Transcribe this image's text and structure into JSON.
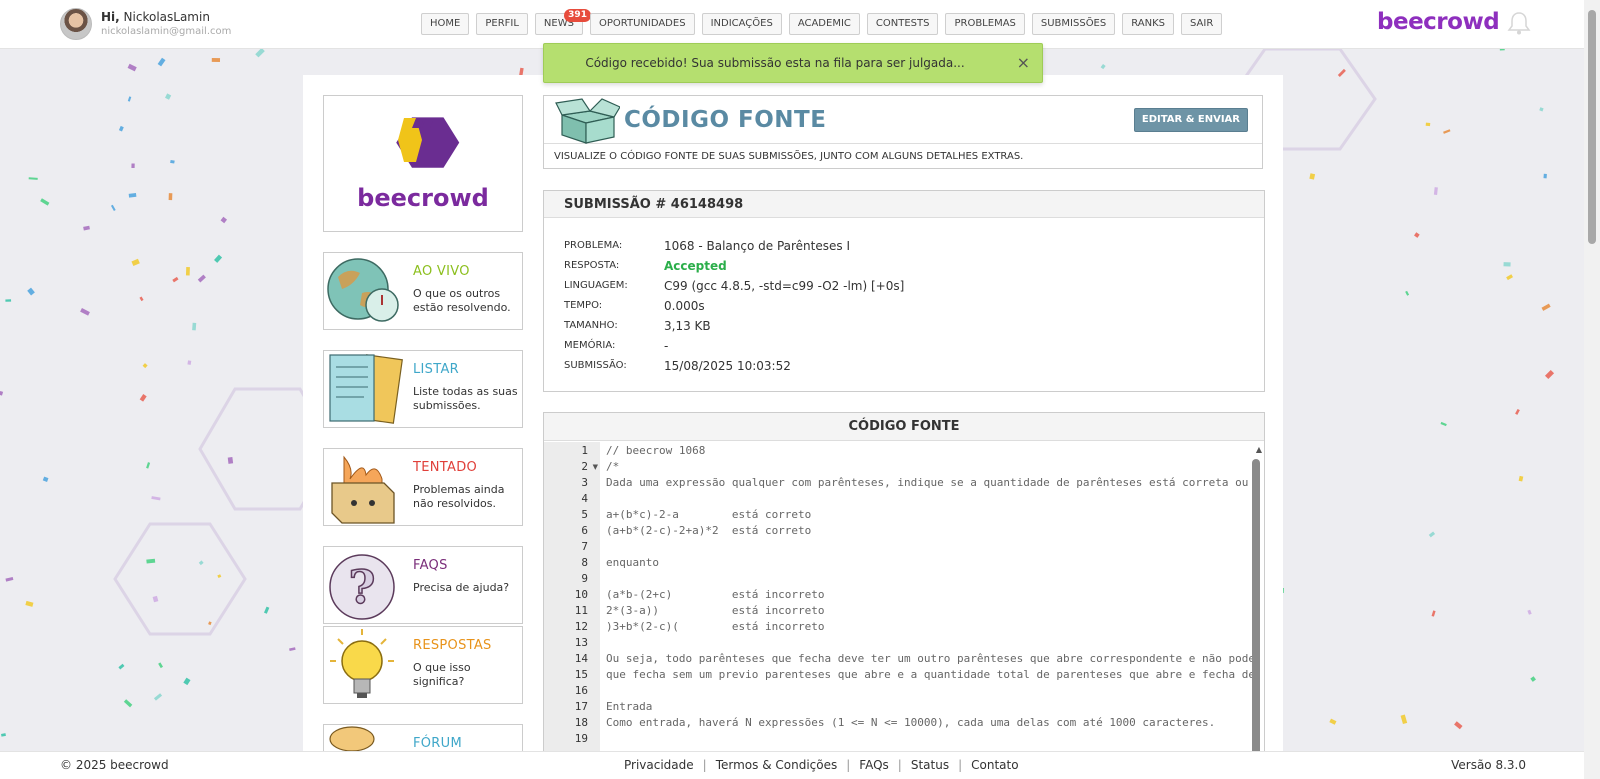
{
  "user": {
    "greeting": "Hi,",
    "name": "NickolasLamin",
    "email": "nickolaslamin@gmail.com"
  },
  "nav": [
    {
      "label": "HOME"
    },
    {
      "label": "PERFIL"
    },
    {
      "label": "NEWS",
      "badge": "391"
    },
    {
      "label": "OPORTUNIDADES"
    },
    {
      "label": "INDICAÇÕES"
    },
    {
      "label": "ACADEMIC"
    },
    {
      "label": "CONTESTS"
    },
    {
      "label": "PROBLEMAS"
    },
    {
      "label": "SUBMISSÕES"
    },
    {
      "label": "RANKS"
    },
    {
      "label": "SAIR"
    }
  ],
  "brand": "beecrowd",
  "toast": {
    "message": "Código recebido! Sua submissão esta na fila para ser julgada...",
    "close": "×"
  },
  "sidebar": {
    "logo_text": "beecrowd",
    "cards": [
      {
        "title": "AO VIVO",
        "desc": "O que os outros estão resolvendo.",
        "color": "#8cbf1e"
      },
      {
        "title": "LISTAR",
        "desc": "Liste todas as suas submissões.",
        "color": "#3fa7c9"
      },
      {
        "title": "TENTADO",
        "desc": "Problemas ainda não resolvidos.",
        "color": "#e0403a"
      },
      {
        "title": "FAQS",
        "desc": "Precisa de ajuda?",
        "color": "#7a2e7a"
      },
      {
        "title": "RESPOSTAS",
        "desc": "O que isso significa?",
        "color": "#e8931b"
      },
      {
        "title": "FÓRUM",
        "desc": "",
        "color": "#3fa7c9"
      }
    ]
  },
  "header": {
    "title": "CÓDIGO FONTE",
    "edit_button": "EDITAR & ENVIAR",
    "subtitle": "VISUALIZE O CÓDIGO FONTE DE SUAS SUBMISSÕES, JUNTO COM ALGUNS DETALHES EXTRAS."
  },
  "submission": {
    "title": "SUBMISSÃO # 46148498",
    "rows": [
      {
        "label": "PROBLEMA:",
        "value": "1068 - Balanço de Parênteses I"
      },
      {
        "label": "RESPOSTA:",
        "value": "Accepted"
      },
      {
        "label": "LINGUAGEM:",
        "value": "C99 (gcc 4.8.5, -std=c99 -O2 -lm) [+0s]"
      },
      {
        "label": "TEMPO:",
        "value": "0.000s"
      },
      {
        "label": "TAMANHO:",
        "value": "3,13 KB"
      },
      {
        "label": "MEMÓRIA:",
        "value": "-"
      },
      {
        "label": "SUBMISSÃO:",
        "value": "15/08/2025 10:03:52"
      }
    ]
  },
  "code": {
    "title": "CÓDIGO FONTE",
    "lines": [
      "// beecrow 1068",
      "/*",
      "Dada uma expressão qualquer com parênteses, indique se a quantidade de parênteses está correta ou",
      "",
      "a+(b*c)-2-a        está correto",
      "(a+b*(2-c)-2+a)*2  está correto",
      "",
      "enquanto",
      "",
      "(a*b-(2+c)         está incorreto",
      "2*(3-a))           está incorreto",
      ")3+b*(2-c)(        está incorreto",
      "",
      "Ou seja, todo parênteses que fecha deve ter um outro parênteses que abre correspondente e não pode",
      "que fecha sem um previo parenteses que abre e a quantidade total de parenteses que abre e fecha de",
      "",
      "Entrada",
      "Como entrada, haverá N expressões (1 <= N <= 10000), cada uma delas com até 1000 caracteres.",
      ""
    ]
  },
  "footer": {
    "copyright": "© 2025 beecrowd",
    "links": [
      "Privacidade",
      "Termos & Condições",
      "FAQs",
      "Status",
      "Contato"
    ],
    "version": "Versão 8.3.0"
  }
}
